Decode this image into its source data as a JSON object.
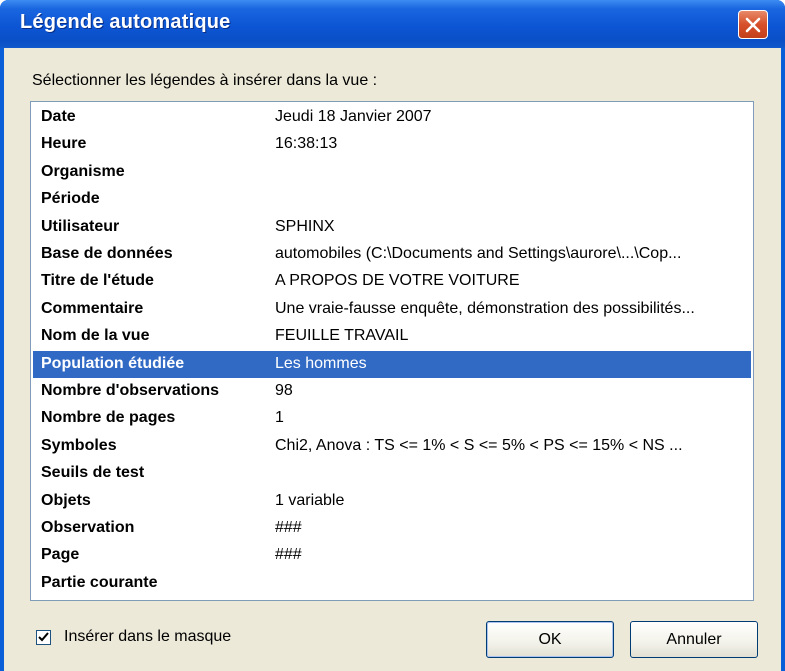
{
  "window": {
    "title": "Légende automatique",
    "close_label": "Fermer"
  },
  "prompt": "Sélectionner les légendes à insérer dans la vue :",
  "rows": [
    {
      "label": "Date",
      "value": "Jeudi 18 Janvier 2007"
    },
    {
      "label": "Heure",
      "value": "16:38:13"
    },
    {
      "label": "Organisme",
      "value": ""
    },
    {
      "label": "Période",
      "value": ""
    },
    {
      "label": "Utilisateur",
      "value": "SPHINX"
    },
    {
      "label": "Base de données",
      "value": "automobiles (C:\\Documents and Settings\\aurore\\...\\Cop..."
    },
    {
      "label": "Titre de l'étude",
      "value": "A PROPOS DE VOTRE VOITURE"
    },
    {
      "label": "Commentaire",
      "value": "Une vraie-fausse enquête, démonstration des possibilités..."
    },
    {
      "label": "Nom de la vue",
      "value": "FEUILLE TRAVAIL"
    },
    {
      "label": "Population étudiée",
      "value": "Les hommes"
    },
    {
      "label": "Nombre d'observations",
      "value": "98"
    },
    {
      "label": "Nombre de pages",
      "value": "1"
    },
    {
      "label": "Symboles",
      "value": "Chi2, Anova : TS <= 1% < S <= 5% < PS <= 15% < NS    ..."
    },
    {
      "label": "Seuils de test",
      "value": ""
    },
    {
      "label": "Objets",
      "value": "1 variable"
    },
    {
      "label": "Observation",
      "value": "###"
    },
    {
      "label": "Page",
      "value": "###"
    },
    {
      "label": "Partie courante",
      "value": ""
    }
  ],
  "selected_row": "Population étudiée",
  "checkbox": {
    "label": "Insérer dans le masque",
    "checked": true
  },
  "buttons": {
    "ok": "OK",
    "cancel": "Annuler"
  },
  "colors": {
    "titlebar": "#0a5ed8",
    "selection": "#316ac5",
    "dialog_bg": "#ece9d8",
    "close_button": "#d6502a"
  }
}
